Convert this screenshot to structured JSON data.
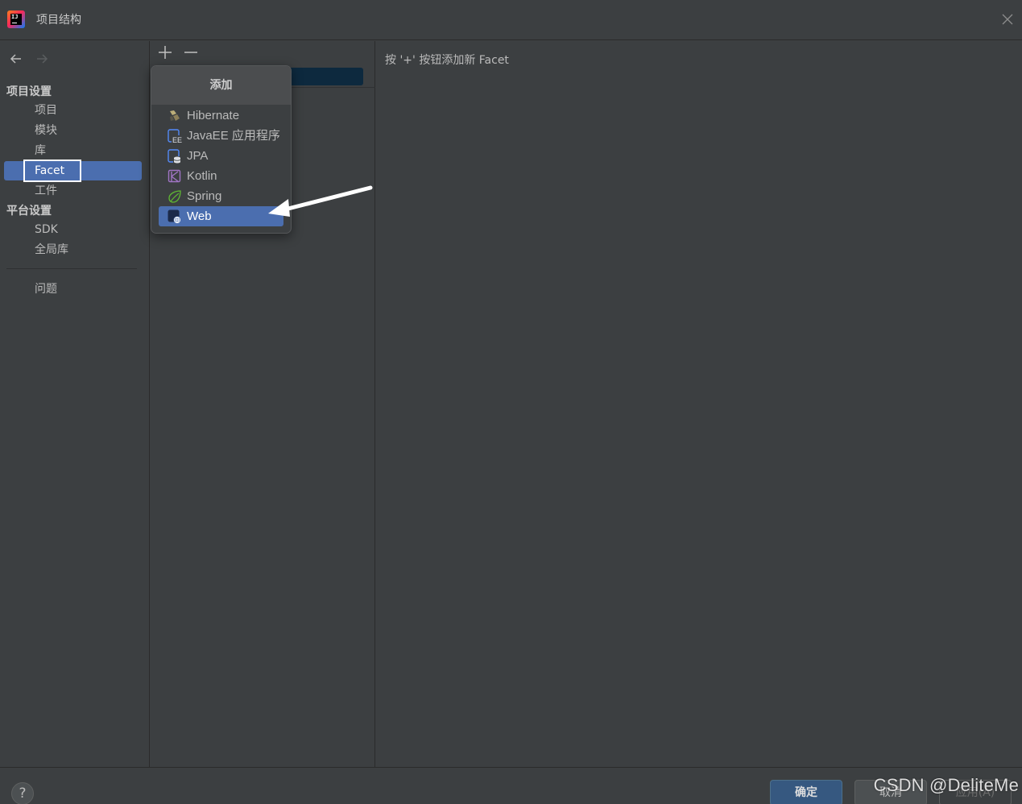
{
  "window": {
    "title": "项目结构",
    "logo_icon": "intellij-idea-icon",
    "logo_text": "IJ"
  },
  "sidebar": {
    "project_settings_title": "项目设置",
    "project_items": [
      {
        "label": "项目",
        "icon": null
      },
      {
        "label": "模块"
      },
      {
        "label": "库"
      },
      {
        "label": "Facet",
        "selected": true
      },
      {
        "label": "工件"
      }
    ],
    "platform_settings_title": "平台设置",
    "platform_items": [
      {
        "label": "SDK"
      },
      {
        "label": "全局库"
      }
    ],
    "problems_label": "问题"
  },
  "middle": {
    "add_icon": "plus-icon",
    "remove_icon": "minus-icon"
  },
  "popup": {
    "header": "添加",
    "items": [
      {
        "label": "Hibernate",
        "icon": "hibernate-icon"
      },
      {
        "label": "JavaEE 应用程序",
        "icon": "javaee-icon"
      },
      {
        "label": "JPA",
        "icon": "jpa-icon"
      },
      {
        "label": "Kotlin",
        "icon": "kotlin-icon"
      },
      {
        "label": "Spring",
        "icon": "spring-icon"
      },
      {
        "label": "Web",
        "icon": "web-icon",
        "selected": true
      }
    ]
  },
  "right_panel": {
    "hint": "按 '+' 按钮添加新 Facet"
  },
  "bottom": {
    "help_label": "?",
    "ok_label": "确定",
    "cancel_label": "取消",
    "apply_label": "应用(A)"
  },
  "watermark": "CSDN @DeliteMe",
  "colors": {
    "background": "#3c3f41",
    "selection": "#4b6eaf",
    "ok_button": "#365880"
  }
}
